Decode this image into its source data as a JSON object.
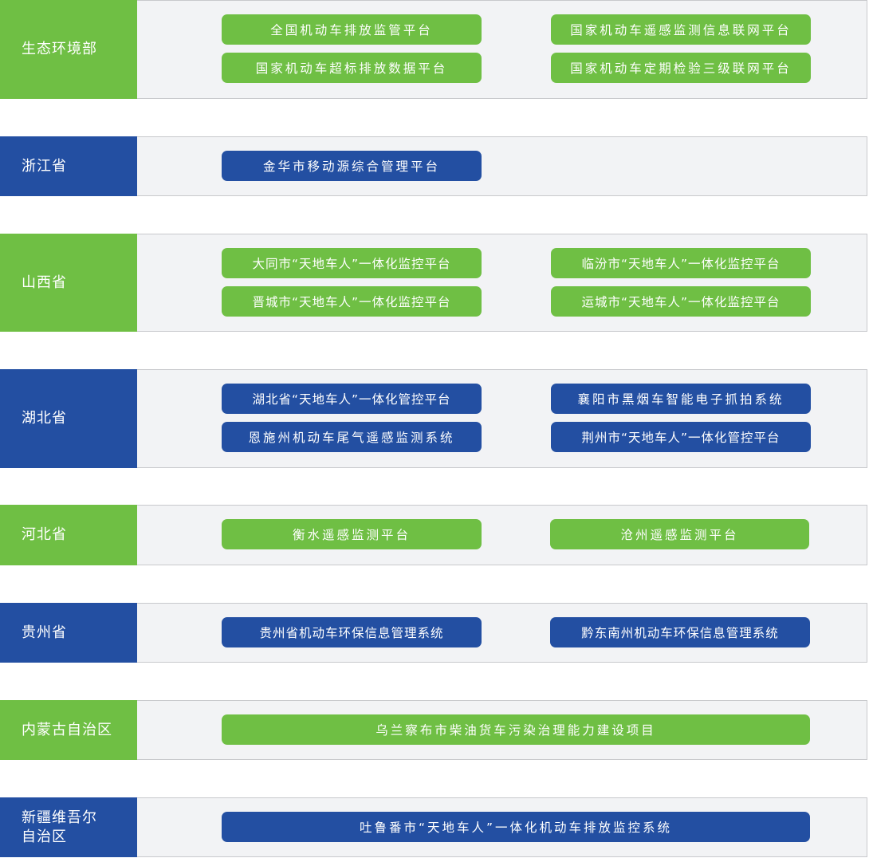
{
  "colors": {
    "green": "#6fbf44",
    "blue": "#234fa2",
    "row_background": "#f2f3f5",
    "row_border": "#c8c9cc"
  },
  "rows": [
    {
      "label": "生态环境部",
      "items": [
        "全国机动车排放监管平台",
        "国家机动车遥感监测信息联网平台",
        "国家机动车超标排放数据平台",
        "国家机动车定期检验三级联网平台"
      ]
    },
    {
      "label": "浙江省",
      "items": [
        "金华市移动源综合管理平台"
      ]
    },
    {
      "label": "山西省",
      "items": [
        "大同市“天地车人”一体化监控平台",
        "临汾市“天地车人”一体化监控平台",
        "晋城市“天地车人”一体化监控平台",
        "运城市“天地车人”一体化监控平台"
      ]
    },
    {
      "label": "湖北省",
      "items": [
        "湖北省“天地车人”一体化管控平台",
        "襄阳市黑烟车智能电子抓拍系统",
        "恩施州机动车尾气遥感监测系统",
        "荆州市“天地车人”一体化管控平台"
      ]
    },
    {
      "label": "河北省",
      "items": [
        "衡水遥感监测平台",
        "沧州遥感监测平台"
      ]
    },
    {
      "label": "贵州省",
      "items": [
        "贵州省机动车环保信息管理系统",
        "黔东南州机动车环保信息管理系统"
      ]
    },
    {
      "label": "内蒙古自治区",
      "items": [
        "乌兰察布市柴油货车污染治理能力建设项目"
      ]
    },
    {
      "label": "新疆维吾尔\n自治区",
      "items": [
        "吐鲁番市“天地车人”一体化机动车排放监控系统"
      ]
    }
  ]
}
